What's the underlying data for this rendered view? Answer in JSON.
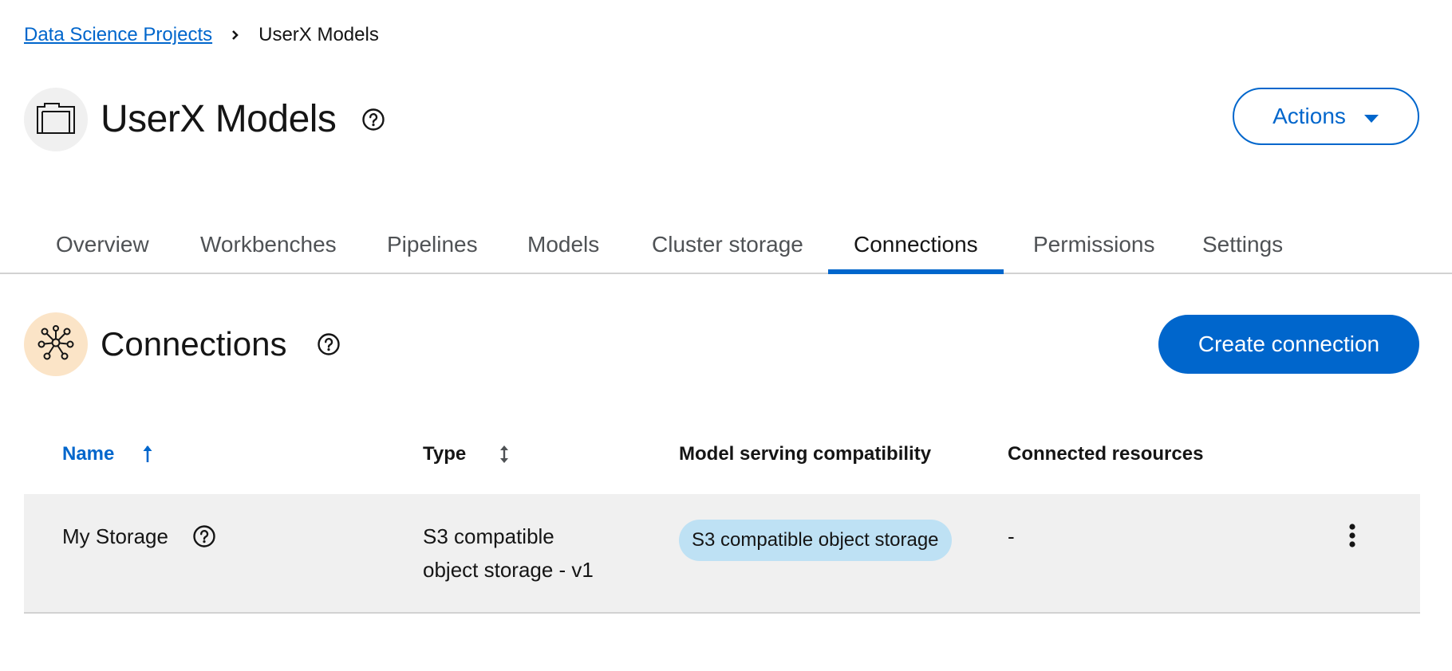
{
  "breadcrumb": {
    "parent": "Data Science Projects",
    "current": "UserX Models"
  },
  "project": {
    "title": "UserX Models",
    "actions_label": "Actions"
  },
  "tabs": [
    {
      "label": "Overview"
    },
    {
      "label": "Workbenches"
    },
    {
      "label": "Pipelines"
    },
    {
      "label": "Models"
    },
    {
      "label": "Cluster storage"
    },
    {
      "label": "Connections",
      "active": true
    },
    {
      "label": "Permissions"
    },
    {
      "label": "Settings"
    }
  ],
  "section": {
    "title": "Connections",
    "create_label": "Create connection"
  },
  "table": {
    "columns": [
      "Name",
      "Type",
      "Model serving compatibility",
      "Connected resources"
    ],
    "rows": [
      {
        "name": "My Storage",
        "type_line1": "S3 compatible",
        "type_line2": "object storage - v1",
        "compatibility": "S3 compatible object storage",
        "connected_resources": "-"
      }
    ]
  },
  "colors": {
    "accent": "#0066cc",
    "row_bg": "#f0f0f0",
    "badge_bg": "#bee1f4",
    "connections_icon_bg": "#fbe4c7"
  },
  "icons": [
    "chevron-right-icon",
    "folder-icon",
    "help-circle-icon",
    "caret-down-icon",
    "network-icon",
    "sort-ascending-icon",
    "sort-icon",
    "kebab-icon"
  ]
}
